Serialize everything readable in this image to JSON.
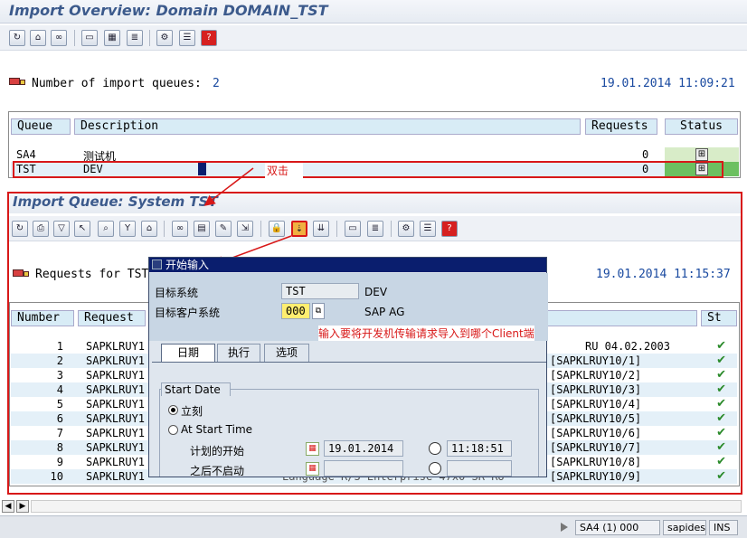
{
  "overview": {
    "title": "Import Overview: Domain DOMAIN_TST",
    "queues_label": "Number of import queues:",
    "queues_count": "2",
    "datetime": "19.01.2014  11:09:21",
    "columns": [
      "Queue",
      "Description",
      "Requests",
      "Status"
    ],
    "rows": [
      {
        "queue": "SA4",
        "description": "测试机",
        "requests": "0"
      },
      {
        "queue": "TST",
        "description": "DEV",
        "requests": "0"
      }
    ],
    "annotation": "双击"
  },
  "import_queue": {
    "title": "Import Queue: System TST",
    "requests_label": "Requests for TST",
    "datetime": "19.01.2014  11:15:37",
    "columns": [
      "Number",
      "Request",
      "St"
    ],
    "rows": [
      {
        "number": "1",
        "request": "SAPKLRUY1",
        "extra": "RU 04.02.2003"
      },
      {
        "number": "2",
        "request": "SAPKLRUY1",
        "extra": "[SAPKLRUY10/1]"
      },
      {
        "number": "3",
        "request": "SAPKLRUY1",
        "extra": "[SAPKLRUY10/2]"
      },
      {
        "number": "4",
        "request": "SAPKLRUY1",
        "extra": "[SAPKLRUY10/3]"
      },
      {
        "number": "5",
        "request": "SAPKLRUY1",
        "extra": "[SAPKLRUY10/4]"
      },
      {
        "number": "6",
        "request": "SAPKLRUY1",
        "extra": "[SAPKLRUY10/5]"
      },
      {
        "number": "7",
        "request": "SAPKLRUY1",
        "extra": "[SAPKLRUY10/6]"
      },
      {
        "number": "8",
        "request": "SAPKLRUY1",
        "extra": "[SAPKLRUY10/7]"
      },
      {
        "number": "9",
        "request": "SAPKLRUY1",
        "extra": "[SAPKLRUY10/8]"
      },
      {
        "number": "10",
        "request": "SAPKLRUY1",
        "extra": "[SAPKLRUY10/9]"
      }
    ],
    "row10_partial": "Language R/3 Enterprise 47x0 SR RU"
  },
  "dialog": {
    "title": "开始输入",
    "target_system_label": "目标系统",
    "target_system_value": "TST",
    "target_system_desc": "DEV",
    "target_client_label": "目标客户系统",
    "target_client_value": "000",
    "target_client_desc": "SAP AG",
    "annotation": "输入要将开发机传输请求导入到哪个Client端",
    "tabs": [
      "日期",
      "执行",
      "选项"
    ],
    "group_title": "Start Date",
    "radio_immediate": "立刻",
    "radio_start_time": "At Start Time",
    "planned_start_label": "计划的开始",
    "planned_date": "19.01.2014",
    "planned_time": "11:18:51",
    "no_start_after_label": "之后不启动"
  },
  "statusbar": {
    "system": "SA4 (1) 000",
    "server": "sapides",
    "mode": "INS"
  }
}
